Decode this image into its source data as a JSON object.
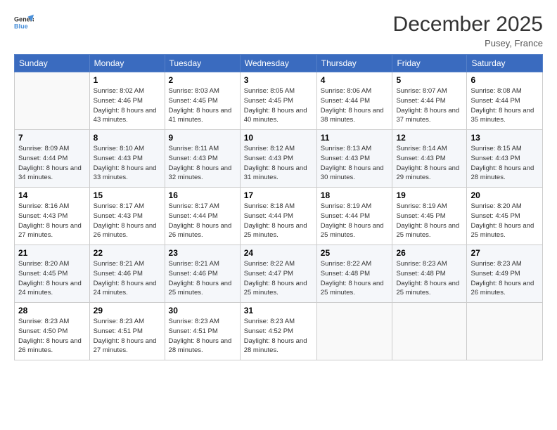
{
  "header": {
    "title": "December 2025",
    "location": "Pusey, France"
  },
  "columns": [
    "Sunday",
    "Monday",
    "Tuesday",
    "Wednesday",
    "Thursday",
    "Friday",
    "Saturday"
  ],
  "weeks": [
    [
      {
        "day": "",
        "sunrise": "",
        "sunset": "",
        "daylight": ""
      },
      {
        "day": "1",
        "sunrise": "Sunrise: 8:02 AM",
        "sunset": "Sunset: 4:46 PM",
        "daylight": "Daylight: 8 hours and 43 minutes."
      },
      {
        "day": "2",
        "sunrise": "Sunrise: 8:03 AM",
        "sunset": "Sunset: 4:45 PM",
        "daylight": "Daylight: 8 hours and 41 minutes."
      },
      {
        "day": "3",
        "sunrise": "Sunrise: 8:05 AM",
        "sunset": "Sunset: 4:45 PM",
        "daylight": "Daylight: 8 hours and 40 minutes."
      },
      {
        "day": "4",
        "sunrise": "Sunrise: 8:06 AM",
        "sunset": "Sunset: 4:44 PM",
        "daylight": "Daylight: 8 hours and 38 minutes."
      },
      {
        "day": "5",
        "sunrise": "Sunrise: 8:07 AM",
        "sunset": "Sunset: 4:44 PM",
        "daylight": "Daylight: 8 hours and 37 minutes."
      },
      {
        "day": "6",
        "sunrise": "Sunrise: 8:08 AM",
        "sunset": "Sunset: 4:44 PM",
        "daylight": "Daylight: 8 hours and 35 minutes."
      }
    ],
    [
      {
        "day": "7",
        "sunrise": "Sunrise: 8:09 AM",
        "sunset": "Sunset: 4:44 PM",
        "daylight": "Daylight: 8 hours and 34 minutes."
      },
      {
        "day": "8",
        "sunrise": "Sunrise: 8:10 AM",
        "sunset": "Sunset: 4:43 PM",
        "daylight": "Daylight: 8 hours and 33 minutes."
      },
      {
        "day": "9",
        "sunrise": "Sunrise: 8:11 AM",
        "sunset": "Sunset: 4:43 PM",
        "daylight": "Daylight: 8 hours and 32 minutes."
      },
      {
        "day": "10",
        "sunrise": "Sunrise: 8:12 AM",
        "sunset": "Sunset: 4:43 PM",
        "daylight": "Daylight: 8 hours and 31 minutes."
      },
      {
        "day": "11",
        "sunrise": "Sunrise: 8:13 AM",
        "sunset": "Sunset: 4:43 PM",
        "daylight": "Daylight: 8 hours and 30 minutes."
      },
      {
        "day": "12",
        "sunrise": "Sunrise: 8:14 AM",
        "sunset": "Sunset: 4:43 PM",
        "daylight": "Daylight: 8 hours and 29 minutes."
      },
      {
        "day": "13",
        "sunrise": "Sunrise: 8:15 AM",
        "sunset": "Sunset: 4:43 PM",
        "daylight": "Daylight: 8 hours and 28 minutes."
      }
    ],
    [
      {
        "day": "14",
        "sunrise": "Sunrise: 8:16 AM",
        "sunset": "Sunset: 4:43 PM",
        "daylight": "Daylight: 8 hours and 27 minutes."
      },
      {
        "day": "15",
        "sunrise": "Sunrise: 8:17 AM",
        "sunset": "Sunset: 4:43 PM",
        "daylight": "Daylight: 8 hours and 26 minutes."
      },
      {
        "day": "16",
        "sunrise": "Sunrise: 8:17 AM",
        "sunset": "Sunset: 4:44 PM",
        "daylight": "Daylight: 8 hours and 26 minutes."
      },
      {
        "day": "17",
        "sunrise": "Sunrise: 8:18 AM",
        "sunset": "Sunset: 4:44 PM",
        "daylight": "Daylight: 8 hours and 25 minutes."
      },
      {
        "day": "18",
        "sunrise": "Sunrise: 8:19 AM",
        "sunset": "Sunset: 4:44 PM",
        "daylight": "Daylight: 8 hours and 25 minutes."
      },
      {
        "day": "19",
        "sunrise": "Sunrise: 8:19 AM",
        "sunset": "Sunset: 4:45 PM",
        "daylight": "Daylight: 8 hours and 25 minutes."
      },
      {
        "day": "20",
        "sunrise": "Sunrise: 8:20 AM",
        "sunset": "Sunset: 4:45 PM",
        "daylight": "Daylight: 8 hours and 25 minutes."
      }
    ],
    [
      {
        "day": "21",
        "sunrise": "Sunrise: 8:20 AM",
        "sunset": "Sunset: 4:45 PM",
        "daylight": "Daylight: 8 hours and 24 minutes."
      },
      {
        "day": "22",
        "sunrise": "Sunrise: 8:21 AM",
        "sunset": "Sunset: 4:46 PM",
        "daylight": "Daylight: 8 hours and 24 minutes."
      },
      {
        "day": "23",
        "sunrise": "Sunrise: 8:21 AM",
        "sunset": "Sunset: 4:46 PM",
        "daylight": "Daylight: 8 hours and 25 minutes."
      },
      {
        "day": "24",
        "sunrise": "Sunrise: 8:22 AM",
        "sunset": "Sunset: 4:47 PM",
        "daylight": "Daylight: 8 hours and 25 minutes."
      },
      {
        "day": "25",
        "sunrise": "Sunrise: 8:22 AM",
        "sunset": "Sunset: 4:48 PM",
        "daylight": "Daylight: 8 hours and 25 minutes."
      },
      {
        "day": "26",
        "sunrise": "Sunrise: 8:23 AM",
        "sunset": "Sunset: 4:48 PM",
        "daylight": "Daylight: 8 hours and 25 minutes."
      },
      {
        "day": "27",
        "sunrise": "Sunrise: 8:23 AM",
        "sunset": "Sunset: 4:49 PM",
        "daylight": "Daylight: 8 hours and 26 minutes."
      }
    ],
    [
      {
        "day": "28",
        "sunrise": "Sunrise: 8:23 AM",
        "sunset": "Sunset: 4:50 PM",
        "daylight": "Daylight: 8 hours and 26 minutes."
      },
      {
        "day": "29",
        "sunrise": "Sunrise: 8:23 AM",
        "sunset": "Sunset: 4:51 PM",
        "daylight": "Daylight: 8 hours and 27 minutes."
      },
      {
        "day": "30",
        "sunrise": "Sunrise: 8:23 AM",
        "sunset": "Sunset: 4:51 PM",
        "daylight": "Daylight: 8 hours and 28 minutes."
      },
      {
        "day": "31",
        "sunrise": "Sunrise: 8:23 AM",
        "sunset": "Sunset: 4:52 PM",
        "daylight": "Daylight: 8 hours and 28 minutes."
      },
      {
        "day": "",
        "sunrise": "",
        "sunset": "",
        "daylight": ""
      },
      {
        "day": "",
        "sunrise": "",
        "sunset": "",
        "daylight": ""
      },
      {
        "day": "",
        "sunrise": "",
        "sunset": "",
        "daylight": ""
      }
    ]
  ]
}
